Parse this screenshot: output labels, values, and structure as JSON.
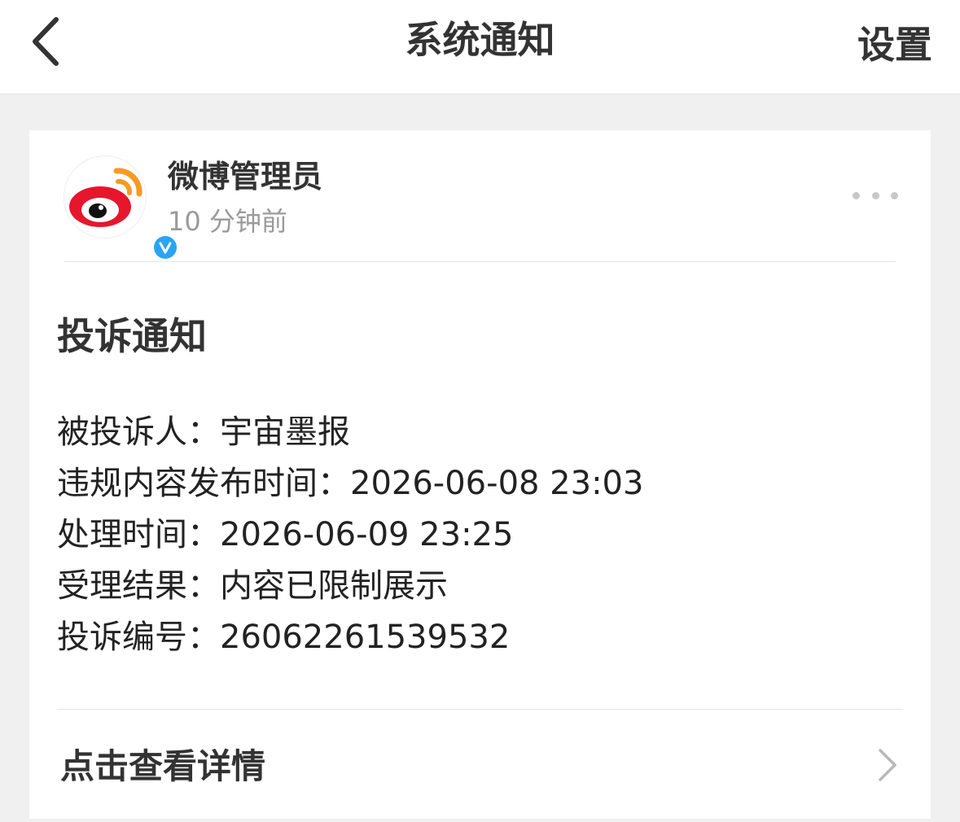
{
  "navbar": {
    "title": "系统通知",
    "settings_label": "设置",
    "back_icon": "chevron-left-icon"
  },
  "message": {
    "sender_name": "微博管理员",
    "time_ago": "10 分钟前",
    "avatar_icon": "weibo-logo-icon",
    "badge_icon": "verified-v-icon",
    "more_icon": "more-dots-icon",
    "brand_colors": {
      "red": "#e6162d",
      "orange": "#f59a23",
      "badge_blue": "#2aa4f4"
    }
  },
  "notice": {
    "title": "投诉通知",
    "rows": [
      {
        "label": "被投诉人：",
        "value": "宇宙墨报"
      },
      {
        "label": "违规内容发布时间：",
        "value": "2026-06-08 23:03"
      },
      {
        "label": "处理时间：",
        "value": "2026-06-09 23:25"
      },
      {
        "label": "受理结果：",
        "value": "内容已限制展示"
      },
      {
        "label": "投诉编号：",
        "value": "26062261539532"
      }
    ]
  },
  "footer": {
    "view_details_label": "点击查看详情",
    "chevron_icon": "chevron-right-icon"
  }
}
